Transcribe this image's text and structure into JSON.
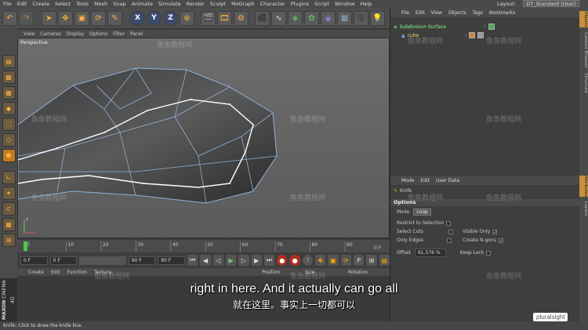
{
  "menu": {
    "items": [
      "File",
      "Edit",
      "Create",
      "Select",
      "Tools",
      "Mesh",
      "Snap",
      "Animate",
      "Simulate",
      "Render",
      "Sculpt",
      "MoGraph",
      "Character",
      "Plugins",
      "Script",
      "Window",
      "Help"
    ]
  },
  "layout": {
    "label": "Layout:",
    "value": "DT_Standard (User)"
  },
  "toolbar": {
    "axis_x": "X",
    "axis_y": "Y",
    "axis_z": "Z"
  },
  "viewport": {
    "menu": [
      "View",
      "Cameras",
      "Display",
      "Options",
      "Filter",
      "Panel"
    ],
    "label": "Perspective"
  },
  "timeline": {
    "ticks": [
      "0",
      "10",
      "20",
      "30",
      "40",
      "50",
      "60",
      "70",
      "80",
      "90"
    ],
    "end_label": "0 F"
  },
  "playback": {
    "current": "0 F",
    "min": "0 F",
    "max": "90 F",
    "end": "90 F"
  },
  "material_menu": [
    "Create",
    "Edit",
    "Function",
    "Texture"
  ],
  "coords": {
    "position": "Position",
    "size": "Size",
    "rotation": "Rotation"
  },
  "maxon": {
    "brand": "MAXON",
    "product": "CINEMA 4D"
  },
  "objects": {
    "menu": [
      "File",
      "Edit",
      "View",
      "Objects",
      "Tags",
      "Bookmarks"
    ],
    "rows": [
      {
        "name": "Subdivision Surface"
      },
      {
        "name": "cube"
      }
    ]
  },
  "attributes": {
    "menu": [
      "Mode",
      "Edit",
      "User Data"
    ],
    "tool": "Knife",
    "options_header": "Options",
    "mode_label": "Mode",
    "mode_value": "Loop",
    "restrict": "Restrict to Selection",
    "select_cuts": "Select Cuts",
    "only_edges": "Only Edges",
    "visible_only": "Visible Only",
    "create_ngons": "Create N-gons",
    "offset_label": "Offset",
    "offset_value": "61.576 %",
    "keep_lock": "Keep Lock"
  },
  "right_tabs": [
    "Objects",
    "Content Browser",
    "Structure",
    "Attributes",
    "Layers"
  ],
  "status": "Knife: Click to draw the knife line.",
  "subtitle": {
    "en": "right in here. And it actually can go all",
    "zh": "就在这里。事实上一切都可以"
  },
  "watermark": "鱼鱼教程网",
  "brand": "pluralsight"
}
